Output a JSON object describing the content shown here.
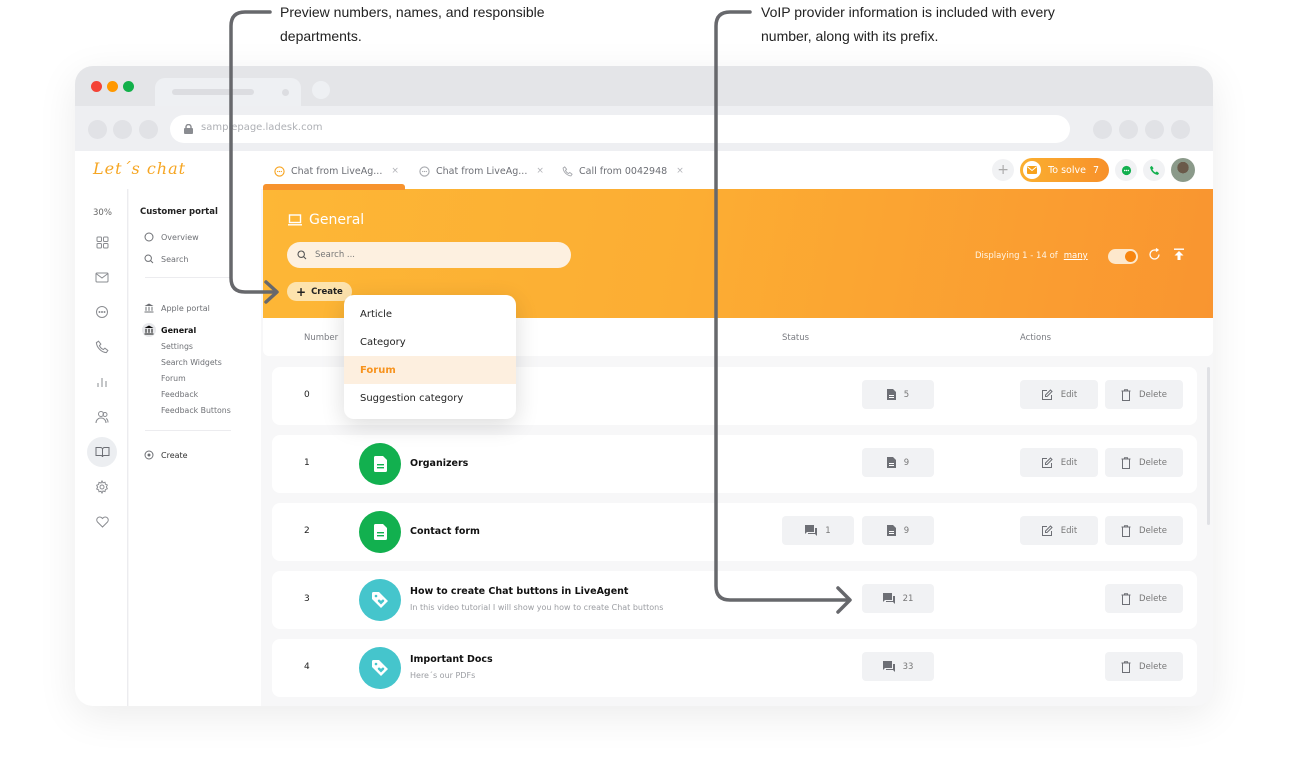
{
  "annotations": {
    "left": "Preview numbers, names, and responsible departments.",
    "right": "VoIP provider information is included with every number, along with its prefix."
  },
  "browser": {
    "url": "samplepage.ladesk.com"
  },
  "app": {
    "logo": "Let´s chat",
    "tabs": [
      {
        "label": "Chat from LiveAg...",
        "icon": "chat-icon",
        "color": "#f7a21b"
      },
      {
        "label": "Chat from LiveAg...",
        "icon": "chat-icon",
        "color": "#a6a8ad"
      },
      {
        "label": "Call from 0042948",
        "icon": "phone-icon",
        "color": "#a6a8ad"
      }
    ],
    "close_glyph": "×",
    "add_glyph": "+",
    "to_solve": {
      "label": "To solve",
      "count": "7"
    }
  },
  "rail": {
    "percent": "30%",
    "icons": [
      "dashboard-icon",
      "mail-icon",
      "chat-icon",
      "phone-icon",
      "reports-icon",
      "contacts-icon",
      "knowledgebase-icon",
      "settings-icon",
      "heart-icon"
    ],
    "active": "knowledgebase-icon"
  },
  "nav": {
    "title": "Customer portal",
    "items": [
      {
        "label": "Overview"
      },
      {
        "label": "Search"
      }
    ],
    "portals": [
      {
        "label": "Apple portal",
        "active": false
      },
      {
        "label": "General",
        "active": true
      }
    ],
    "sub_items": [
      "Settings",
      "Search Widgets",
      "Forum",
      "Feedback",
      "Feedback Buttons"
    ],
    "create_label": "Create"
  },
  "hero": {
    "title": "General",
    "search_placeholder": "Search ...",
    "create_label": "Create",
    "displaying_prefix": "Displaying 1 - 14 of",
    "displaying_link": "many",
    "toggle_on": true
  },
  "table": {
    "columns": [
      "Number",
      "Status",
      "Actions"
    ],
    "rows": [
      {
        "number": "0",
        "title": "",
        "subtitle": "",
        "icon": "file-icon",
        "statuses": [
          {
            "icon": "file-icon",
            "value": "5"
          }
        ],
        "edit": "Edit",
        "delete": "Delete"
      },
      {
        "number": "1",
        "title": "Organizers",
        "subtitle": "",
        "icon": "file-icon",
        "statuses": [
          {
            "icon": "file-icon",
            "value": "9"
          }
        ],
        "edit": "Edit",
        "delete": "Delete"
      },
      {
        "number": "2",
        "title": "Contact form",
        "subtitle": "",
        "icon": "file-icon",
        "statuses": [
          {
            "icon": "comments-icon",
            "value": "1"
          },
          {
            "icon": "file-icon",
            "value": "9"
          }
        ],
        "edit": "Edit",
        "delete": "Delete"
      },
      {
        "number": "3",
        "title": "How to create Chat buttons in LiveAgent",
        "subtitle": "In this video tutorial I will show you how to create Chat buttons",
        "icon": "tag-heart-icon",
        "statuses": [
          {
            "icon": "comments-icon",
            "value": "21"
          }
        ],
        "edit": null,
        "delete": "Delete"
      },
      {
        "number": "4",
        "title": "Important Docs",
        "subtitle": "Here´s our PDFs",
        "icon": "tag-heart-icon",
        "statuses": [
          {
            "icon": "comments-icon",
            "value": "33"
          }
        ],
        "edit": null,
        "delete": "Delete"
      }
    ]
  },
  "dropdown": {
    "items": [
      "Article",
      "Category",
      "Forum",
      "Suggestion category"
    ],
    "highlighted": "Forum"
  },
  "colors": {
    "accent": "#f7931e",
    "hero_start": "#fdb736",
    "hero_end": "#f99530",
    "green": "#12b04f",
    "teal": "#45c5cc"
  }
}
